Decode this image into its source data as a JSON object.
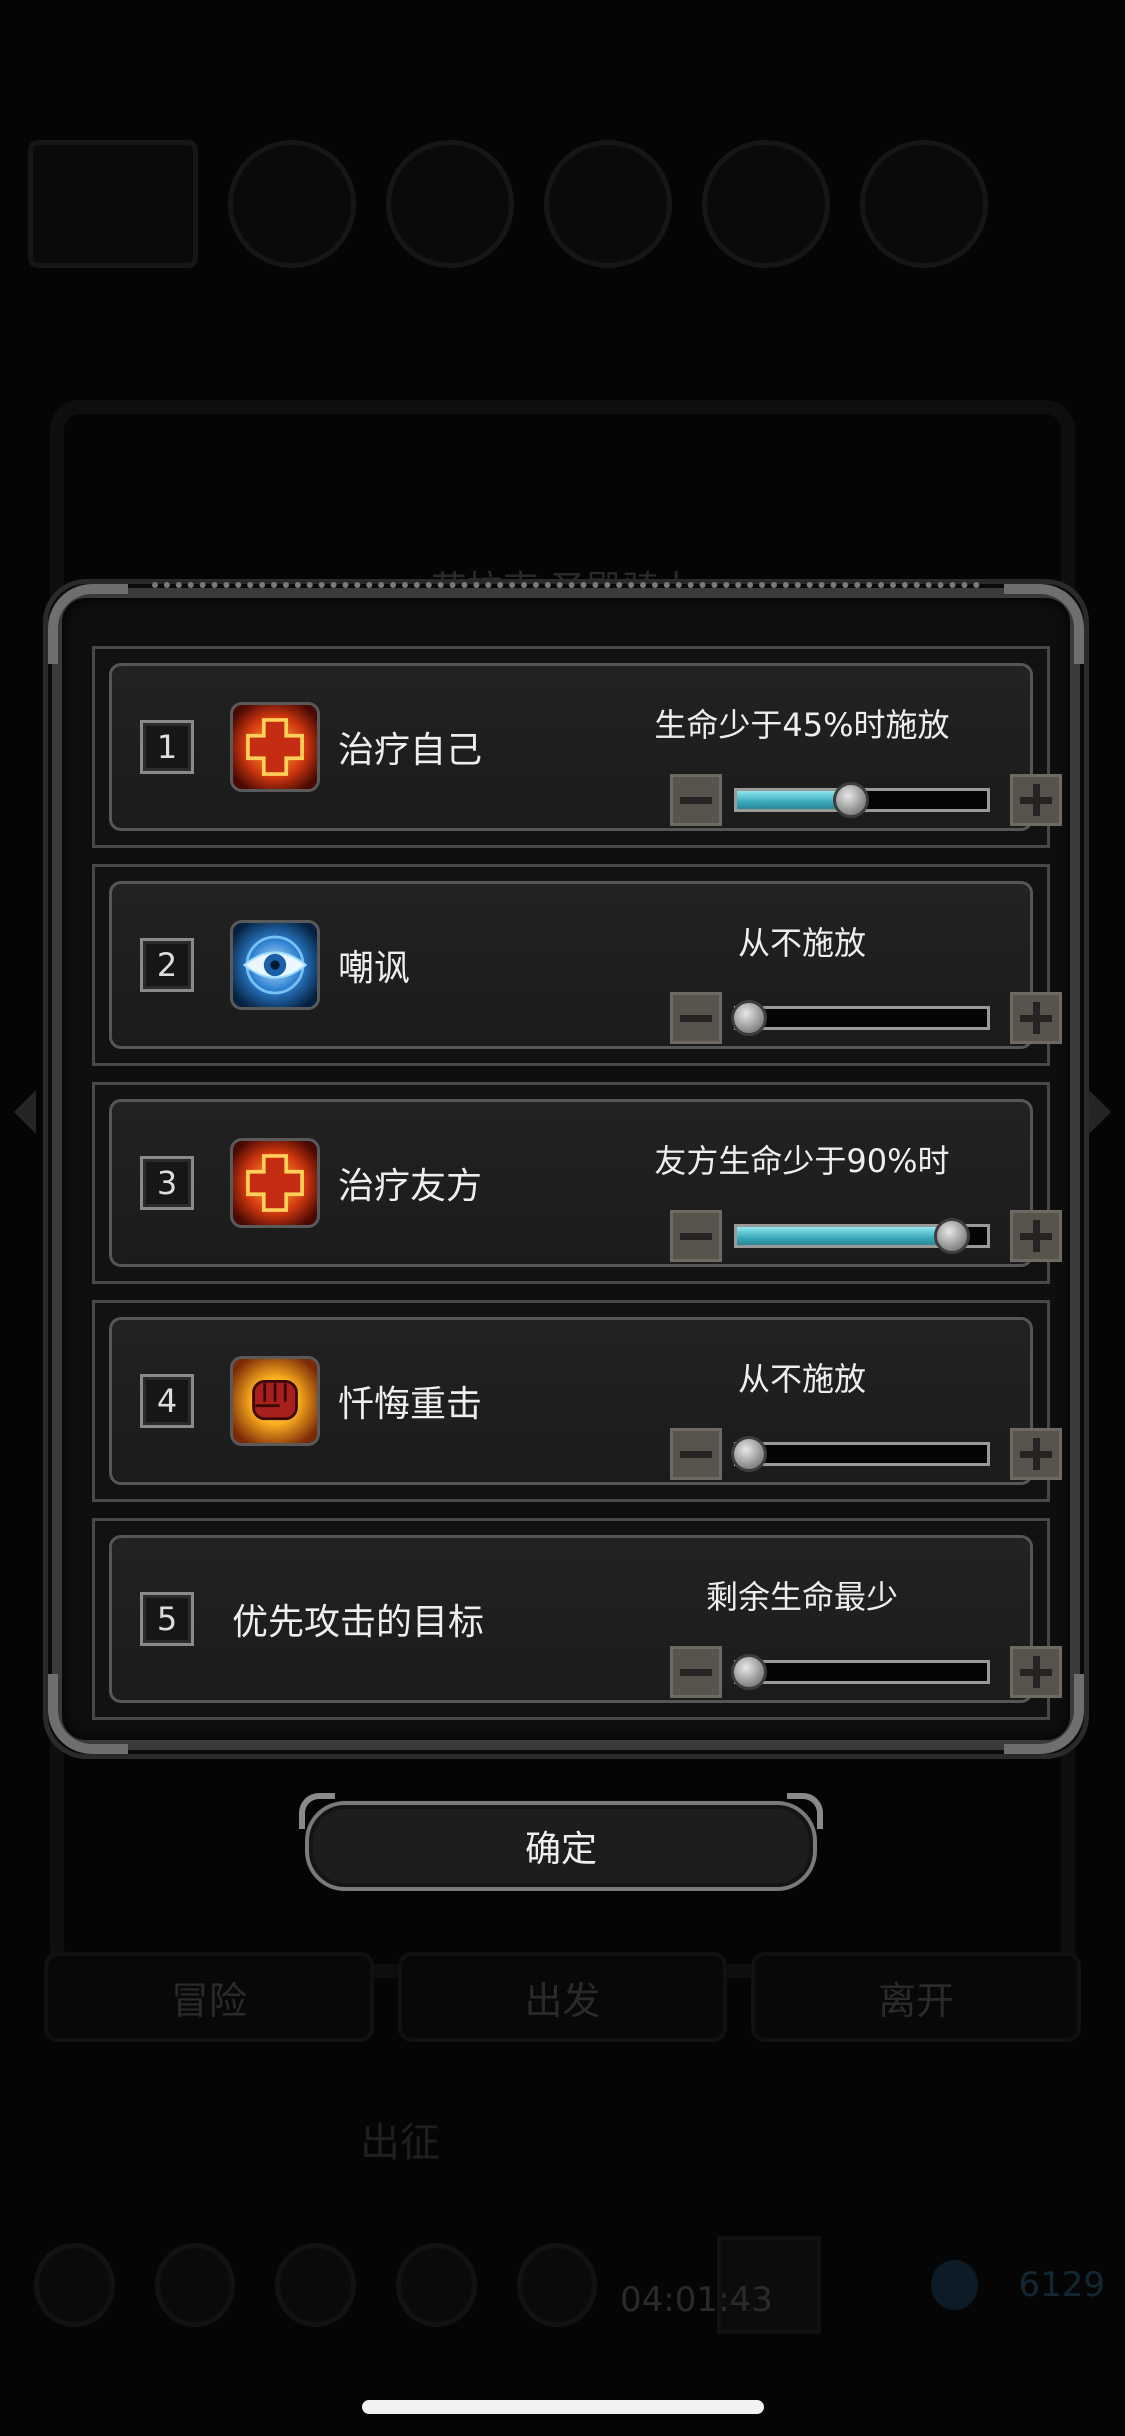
{
  "background": {
    "hero_title": "艾拉克 圣殿骑士",
    "tabs": [
      "冒险",
      "出发",
      "离开"
    ],
    "mid_label": "出征",
    "timer": "04:01:43",
    "gem_count": "6129"
  },
  "rows": [
    {
      "number": "1",
      "icon": "heal-cross-icon",
      "name": "治疗自己",
      "condition": "生命少于45%时施放",
      "slider_value": 0.45
    },
    {
      "number": "2",
      "icon": "eye-taunt-icon",
      "name": "嘲讽",
      "condition": "从不施放",
      "slider_value": 0.0
    },
    {
      "number": "3",
      "icon": "heal-cross-icon",
      "name": "治疗友方",
      "condition": "友方生命少于90%时",
      "slider_value": 0.9
    },
    {
      "number": "4",
      "icon": "fist-strike-icon",
      "name": "忏悔重击",
      "condition": "从不施放",
      "slider_value": 0.0
    },
    {
      "number": "5",
      "name": "优先攻击的目标",
      "condition": "剩余生命最少",
      "slider_value": 0.0
    }
  ],
  "confirm_label": "确定",
  "colors": {
    "slider_fill": "#3aa9bb",
    "button_face": "#58544d",
    "frame": "#3a3a3a"
  }
}
